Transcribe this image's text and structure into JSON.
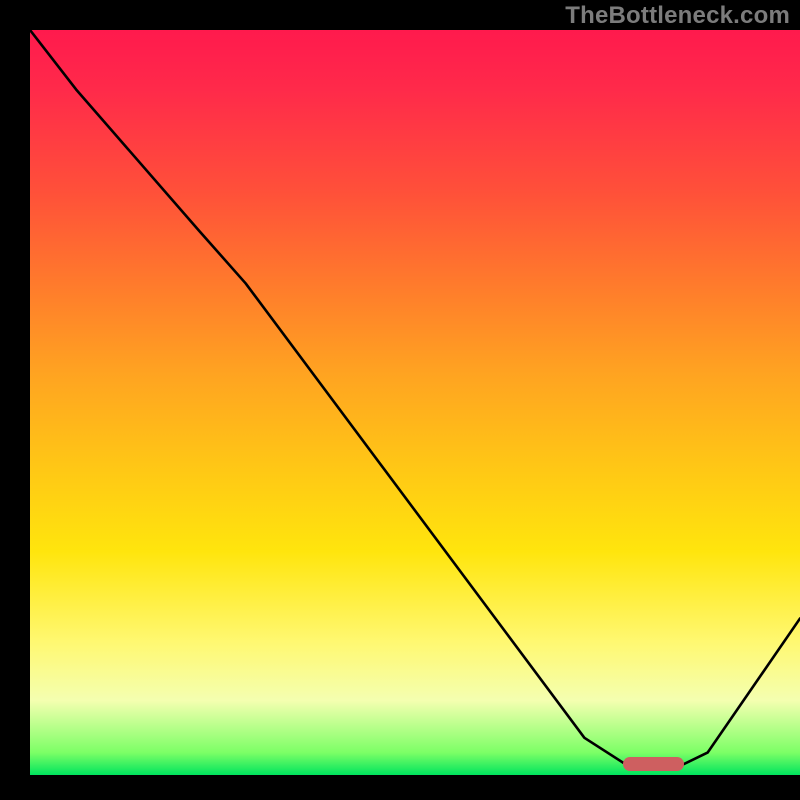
{
  "attribution": "TheBottleneck.com",
  "chart_data": {
    "type": "line",
    "title": "",
    "xlabel": "",
    "ylabel": "",
    "xlim": [
      0,
      100
    ],
    "ylim": [
      0,
      100
    ],
    "grid": false,
    "legend": false,
    "background_gradient": {
      "top": "#ff1a4d",
      "mid": "#ffe50d",
      "bottom": "#00e45e"
    },
    "series": [
      {
        "name": "bottleneck-curve",
        "color": "#000000",
        "x": [
          0,
          6,
          22,
          28,
          72,
          78,
          84,
          88,
          100
        ],
        "values": [
          100,
          92,
          73,
          66,
          5,
          1,
          1,
          3,
          21
        ]
      }
    ],
    "marker": {
      "name": "optimal-range",
      "x_start": 77,
      "x_end": 85,
      "y": 1.5,
      "color": "#ce5f60"
    }
  }
}
